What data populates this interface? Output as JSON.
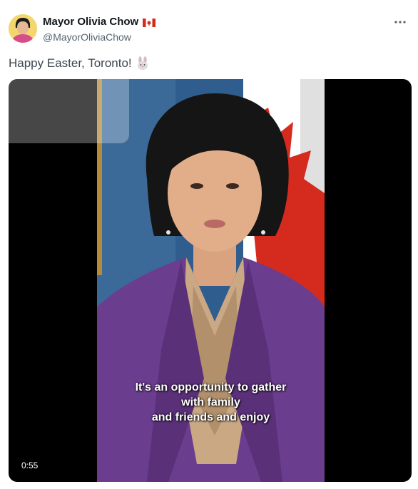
{
  "author": {
    "display_name": "Mayor Olivia Chow",
    "handle": "@MayorOliviaChow",
    "flag_icon": "canada-flag-icon",
    "avatar_icon": "avatar-photo"
  },
  "tweet": {
    "text": "Happy Easter, Toronto!",
    "emoji_icon": "rabbit-face-icon"
  },
  "menu": {
    "icon": "more-options-icon"
  },
  "video": {
    "caption_lines": [
      "It's an opportunity to gather",
      "with family",
      "and friends and enjoy"
    ],
    "duration": "0:55"
  },
  "colors": {
    "text_primary": "#0f1419",
    "text_secondary": "#536471",
    "flag_red": "#d52b1e",
    "jacket_purple": "#6a3d8f"
  }
}
